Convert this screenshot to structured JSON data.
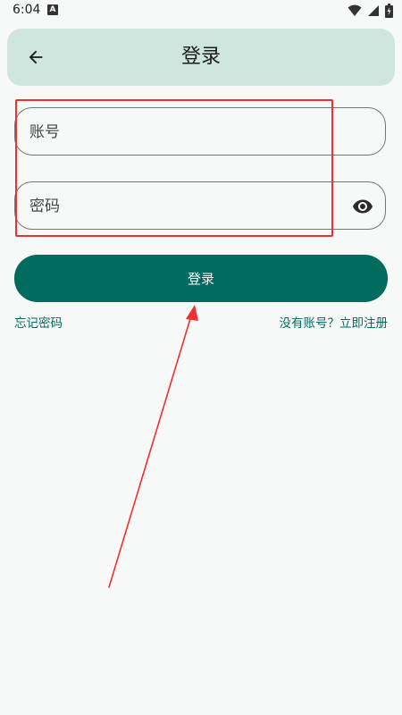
{
  "status_bar": {
    "time": "6:04",
    "notification_icon": "a-icon"
  },
  "app_bar": {
    "title": "登录",
    "back_icon": "arrow-left-icon"
  },
  "form": {
    "account_placeholder": "账号",
    "password_placeholder": "密码",
    "visibility_icon": "eye-icon",
    "login_label": "登录",
    "forgot_label": "忘记密码",
    "register_label": "没有账号？立即注册"
  },
  "colors": {
    "primary": "#006b5f",
    "app_bar_bg": "#cfe6df",
    "background": "#f6f9f7",
    "annotation": "#ef3030"
  }
}
